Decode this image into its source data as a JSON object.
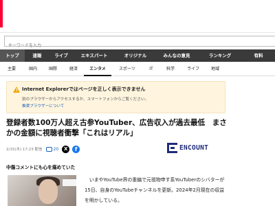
{
  "search": {
    "placeholder": "キーワードを入力"
  },
  "nav": {
    "items": [
      {
        "label": "トップ",
        "active": true
      },
      {
        "label": "速報",
        "active": false
      },
      {
        "label": "ライブ",
        "active": false
      },
      {
        "label": "エキスパート",
        "active": false
      },
      {
        "label": "オリジナル",
        "active": false
      },
      {
        "label": "みんなの意見",
        "active": false
      },
      {
        "label": "ランキング",
        "active": false
      },
      {
        "label": "有料",
        "active": false
      }
    ]
  },
  "subnav": {
    "items": [
      {
        "label": "主要",
        "active": false
      },
      {
        "label": "国内",
        "active": false
      },
      {
        "label": "国際",
        "active": false
      },
      {
        "label": "経済",
        "active": false
      },
      {
        "label": "エンタメ",
        "active": true
      },
      {
        "label": "スポーツ",
        "active": false
      },
      {
        "label": "IT",
        "active": false
      },
      {
        "label": "科学",
        "active": false
      },
      {
        "label": "ライフ",
        "active": false
      },
      {
        "label": "地域",
        "active": false
      }
    ]
  },
  "notice": {
    "title": "Internet Explorerではページを正しく表示できません",
    "body": "別のブラウザーからアクセスするか、スマートフォンからご覧ください。",
    "link": "推奨ブラウザーについて"
  },
  "article": {
    "headline": "登録者数100万人超え古参YouTuber、広告収入が過去最低　まさかの金額に視聴者衝撃「これはリアル」",
    "date": "2/15(木) 17:23 配信",
    "comment_count": "20",
    "source": "ENCOUNT",
    "section_heading": "中傷コメントにも心を痛めていた",
    "body": "　いまやYouTube界の重鎮で元祖物申す系YouTuberのシバターが15日、自身のYouTubeチャンネルを更新。2024年2月現在の収益を明かしている。"
  },
  "colors": {
    "nav_bg": "#3a3a3a",
    "notice_bg": "#fff5df",
    "link": "#1a5fb4",
    "source_brand": "#1e2a78"
  }
}
